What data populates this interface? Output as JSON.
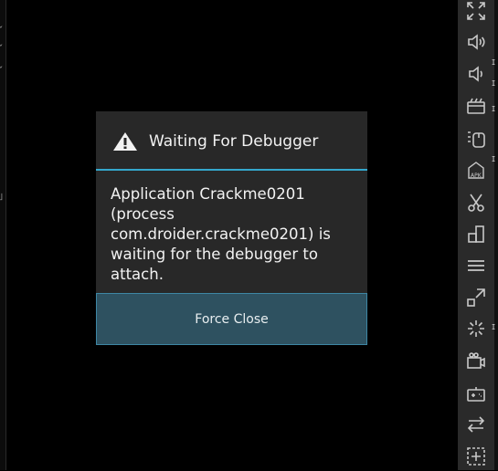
{
  "dialog": {
    "title": "Waiting For Debugger",
    "message": "Application Crackme0201 (process com.droider.crackme0201) is waiting for the debugger to attach.",
    "force_close_label": "Force Close"
  },
  "toolbar": {
    "icons": [
      "fullscreen-icon",
      "volume-up-icon",
      "volume-down-icon",
      "media-icon",
      "device-icon",
      "apk-install-icon",
      "cut-icon",
      "screenshot-icon",
      "menu-icon",
      "resize-icon",
      "loading-icon",
      "camera-icon",
      "gamepad-icon",
      "switch-icon",
      "add-icon"
    ]
  },
  "colors": {
    "accent": "#34a7cc",
    "dialog_bg": "#282828",
    "button_bg": "#2e5160",
    "toolbar_bg": "#2a2a2a"
  }
}
